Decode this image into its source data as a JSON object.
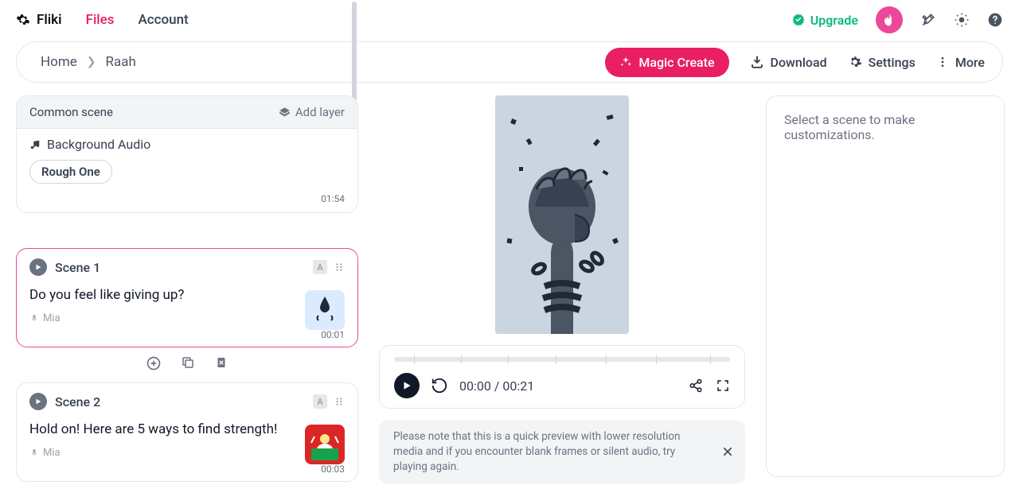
{
  "topbar": {
    "brand": "Fliki",
    "nav_files": "Files",
    "nav_account": "Account",
    "upgrade": "Upgrade"
  },
  "subheader": {
    "breadcrumb_home": "Home",
    "breadcrumb_current": "Raah",
    "magic_create": "Magic Create",
    "download": "Download",
    "settings": "Settings",
    "more": "More"
  },
  "common_scene": {
    "title": "Common scene",
    "add_layer": "Add layer",
    "bg_audio": "Background Audio",
    "track_chip": "Rough One",
    "duration": "01:54"
  },
  "scenes": [
    {
      "label": "Scene 1",
      "text": "Do you feel like giving up?",
      "voice": "Mia",
      "time": "00:01"
    },
    {
      "label": "Scene 2",
      "text": "Hold on! Here are 5 ways to find strength!",
      "voice": "Mia",
      "time": "00:03"
    }
  ],
  "player": {
    "time": "00:00 / 00:21"
  },
  "notice": {
    "text": "Please note that this is a quick preview with lower resolution media and if you encounter blank frames or silent audio, try playing again."
  },
  "right_panel": {
    "placeholder": "Select a scene to make customizations."
  }
}
